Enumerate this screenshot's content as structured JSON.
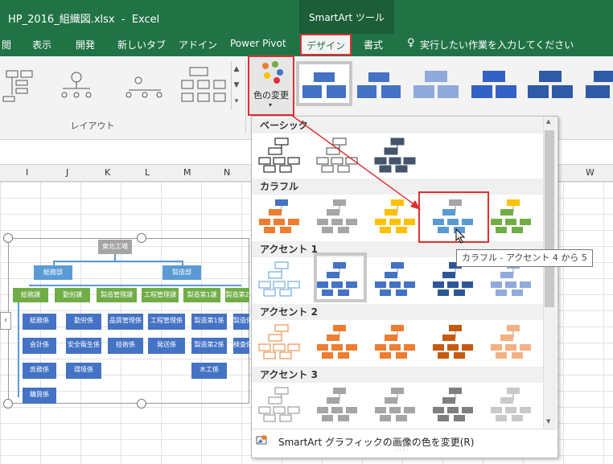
{
  "window": {
    "title": "HP_2016_組織図.xlsx  -  Excel",
    "context_group": "SmartArt ツール"
  },
  "tabs": [
    {
      "label": "閲"
    },
    {
      "label": "表示"
    },
    {
      "label": "開発"
    },
    {
      "label": "新しいタブ"
    },
    {
      "label": "アドイン"
    },
    {
      "label": "Power Pivot"
    },
    {
      "label": "デザイン"
    },
    {
      "label": "書式"
    },
    {
      "label": "実行したい作業を入力してください"
    }
  ],
  "ribbon": {
    "layout_group_label": "レイアウト",
    "change_colors_label": "色の変更"
  },
  "columns": [
    "I",
    "J",
    "K",
    "L",
    "M",
    "N",
    "W"
  ],
  "org": {
    "root": "東北工場",
    "level2": [
      "総務部",
      "製造部"
    ],
    "level3": [
      "総務課",
      "勤労課",
      "製造管理課",
      "工程管理課",
      "製造第1課",
      "製造第2"
    ],
    "leaves": [
      "総務係",
      "会計係",
      "庶務係",
      "購買係",
      "勤労係",
      "安全衛生係",
      "環境係",
      "品質管理係",
      "技術係",
      "工程管理係",
      "発送係",
      "製造第1係",
      "製造第2係",
      "木工係",
      "製造係",
      "検査係"
    ]
  },
  "dropdown": {
    "sections": [
      "ベーシック",
      "カラフル",
      "アクセント 1",
      "アクセント 2",
      "アクセント 3"
    ],
    "footer": "SmartArt グラフィックの画像の色を変更(R)"
  },
  "tooltip": "カラフル - アクセント 4 から 5",
  "colors": {
    "excel_green": "#217346",
    "accent_blue": "#4472c4",
    "light_blue": "#5b9bd5",
    "orange": "#ed7d31",
    "gray": "#a5a5a5",
    "gold": "#ffc000",
    "green": "#70ad47",
    "highlight_red": "#e03030"
  }
}
